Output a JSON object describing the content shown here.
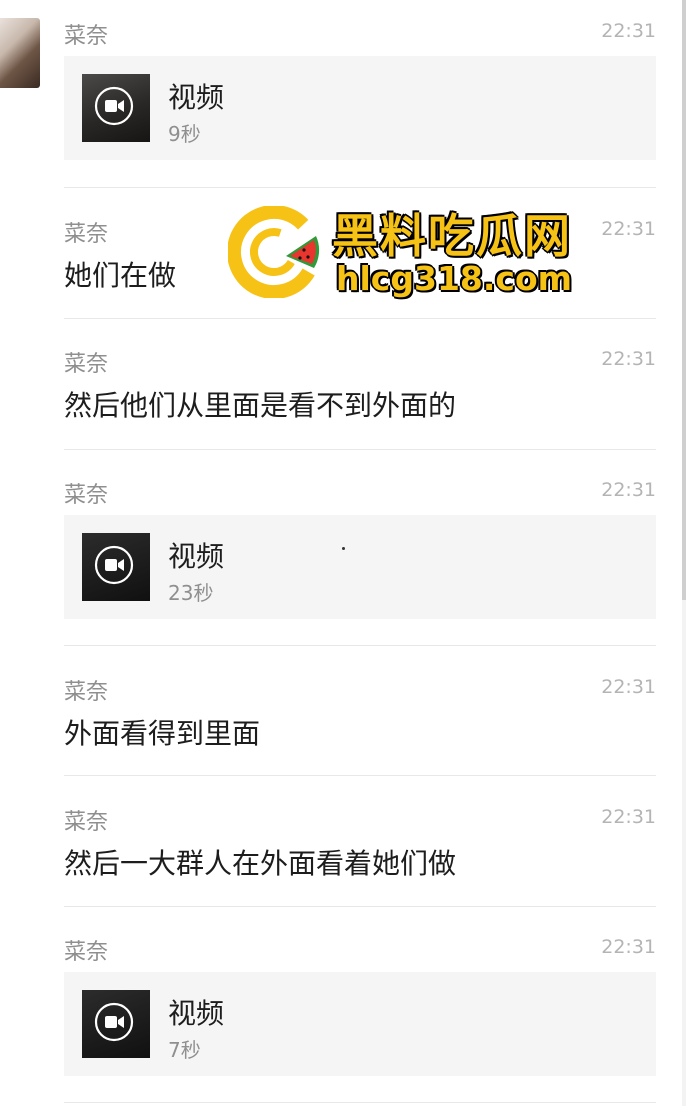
{
  "messages": [
    {
      "type": "video",
      "sender": "菜奈",
      "time": "22:31",
      "video_label": "视频",
      "duration": "9秒"
    },
    {
      "type": "text",
      "sender": "菜奈",
      "time": "22:31",
      "text": "她们在做"
    },
    {
      "type": "text",
      "sender": "菜奈",
      "time": "22:31",
      "text": "然后他们从里面是看不到外面的"
    },
    {
      "type": "video",
      "sender": "菜奈",
      "time": "22:31",
      "video_label": "视频",
      "duration": "23秒"
    },
    {
      "type": "text",
      "sender": "菜奈",
      "time": "22:31",
      "text": "外面看得到里面"
    },
    {
      "type": "text",
      "sender": "菜奈",
      "time": "22:31",
      "text": "然后一大群人在外面看着她们做"
    },
    {
      "type": "video",
      "sender": "菜奈",
      "time": "22:31",
      "video_label": "视频",
      "duration": "7秒"
    }
  ],
  "watermark": {
    "site_name": "黑料吃瓜网",
    "url": "hlcg318.com"
  },
  "colors": {
    "watermark": "#f7c216",
    "sender": "#8f8f8f",
    "time": "#b4b4b4",
    "card": "#f5f5f5"
  },
  "icons": [
    "video-play-icon",
    "site-logo-icon"
  ]
}
